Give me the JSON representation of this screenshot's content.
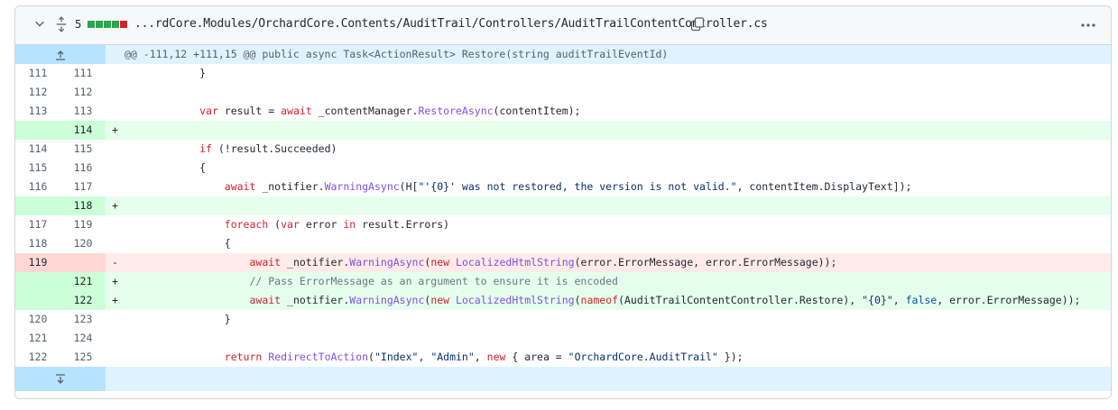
{
  "header": {
    "changes_count": "5",
    "change_blocks": [
      "added",
      "added",
      "added",
      "added",
      "deleted"
    ],
    "file_path": "...rdCore.Modules/OrchardCore.Contents/AuditTrail/Controllers/AuditTrailContentController.cs",
    "icons": [
      "chevron-down-icon",
      "unfold-icon",
      "copy-icon",
      "kebab-horizontal-icon"
    ]
  },
  "hunk": {
    "header_text": "@@ -111,12 +111,15 @@ public async Task<ActionResult> Restore(string auditTrailEventId)"
  },
  "colors": {
    "added_bg": "#e6ffec",
    "added_num_bg": "#ccffd8",
    "deleted_bg": "#ffebe9",
    "deleted_num_bg": "#ffd7d5",
    "hunk_bg": "#ddf4ff",
    "keyword": "#cf222e",
    "method": "#8250df",
    "string": "#0a3069",
    "comment": "#6e7781"
  },
  "lines": [
    {
      "type": "ctx",
      "old": "111",
      "new": "111",
      "sign": "",
      "tokens": [
        {
          "t": "            }",
          "c": ""
        }
      ]
    },
    {
      "type": "ctx",
      "old": "112",
      "new": "112",
      "sign": "",
      "tokens": [
        {
          "t": "",
          "c": ""
        }
      ]
    },
    {
      "type": "ctx",
      "old": "113",
      "new": "113",
      "sign": "",
      "tokens": [
        {
          "t": "            ",
          "c": ""
        },
        {
          "t": "var",
          "c": "kw"
        },
        {
          "t": " result = ",
          "c": ""
        },
        {
          "t": "await",
          "c": "kw"
        },
        {
          "t": " _contentManager.",
          "c": ""
        },
        {
          "t": "RestoreAsync",
          "c": "fn"
        },
        {
          "t": "(contentItem);",
          "c": ""
        }
      ]
    },
    {
      "type": "add",
      "old": "",
      "new": "114",
      "sign": "+",
      "tokens": [
        {
          "t": "",
          "c": ""
        }
      ]
    },
    {
      "type": "ctx",
      "old": "114",
      "new": "115",
      "sign": "",
      "tokens": [
        {
          "t": "            ",
          "c": ""
        },
        {
          "t": "if",
          "c": "kw"
        },
        {
          "t": " (!result.Succeeded)",
          "c": ""
        }
      ]
    },
    {
      "type": "ctx",
      "old": "115",
      "new": "116",
      "sign": "",
      "tokens": [
        {
          "t": "            {",
          "c": ""
        }
      ]
    },
    {
      "type": "ctx",
      "old": "116",
      "new": "117",
      "sign": "",
      "tokens": [
        {
          "t": "                ",
          "c": ""
        },
        {
          "t": "await",
          "c": "kw"
        },
        {
          "t": " _notifier.",
          "c": ""
        },
        {
          "t": "WarningAsync",
          "c": "fn"
        },
        {
          "t": "(H[",
          "c": ""
        },
        {
          "t": "\"'{0}' was not restored, the version is not valid.\"",
          "c": "str"
        },
        {
          "t": ", contentItem.DisplayText]);",
          "c": ""
        }
      ]
    },
    {
      "type": "add",
      "old": "",
      "new": "118",
      "sign": "+",
      "tokens": [
        {
          "t": "",
          "c": ""
        }
      ]
    },
    {
      "type": "ctx",
      "old": "117",
      "new": "119",
      "sign": "",
      "tokens": [
        {
          "t": "                ",
          "c": ""
        },
        {
          "t": "foreach",
          "c": "kw"
        },
        {
          "t": " (",
          "c": ""
        },
        {
          "t": "var",
          "c": "kw"
        },
        {
          "t": " error ",
          "c": ""
        },
        {
          "t": "in",
          "c": "kw"
        },
        {
          "t": " result.Errors)",
          "c": ""
        }
      ]
    },
    {
      "type": "ctx",
      "old": "118",
      "new": "120",
      "sign": "",
      "tokens": [
        {
          "t": "                {",
          "c": ""
        }
      ]
    },
    {
      "type": "del",
      "old": "119",
      "new": "",
      "sign": "-",
      "tokens": [
        {
          "t": "                    ",
          "c": ""
        },
        {
          "t": "await",
          "c": "kw"
        },
        {
          "t": " _notifier.",
          "c": ""
        },
        {
          "t": "WarningAsync",
          "c": "fn"
        },
        {
          "t": "(",
          "c": ""
        },
        {
          "t": "new",
          "c": "kw"
        },
        {
          "t": " ",
          "c": ""
        },
        {
          "t": "LocalizedHtmlString",
          "c": "fn"
        },
        {
          "t": "(error.ErrorMessage, error.ErrorMessage));",
          "c": ""
        }
      ]
    },
    {
      "type": "add",
      "old": "",
      "new": "121",
      "sign": "+",
      "tokens": [
        {
          "t": "                    ",
          "c": ""
        },
        {
          "t": "// Pass ErrorMessage as an argument to ensure it is encoded",
          "c": "cm"
        }
      ]
    },
    {
      "type": "add",
      "old": "",
      "new": "122",
      "sign": "+",
      "tokens": [
        {
          "t": "                    ",
          "c": ""
        },
        {
          "t": "await",
          "c": "kw"
        },
        {
          "t": " _notifier.",
          "c": ""
        },
        {
          "t": "WarningAsync",
          "c": "fn"
        },
        {
          "t": "(",
          "c": ""
        },
        {
          "t": "new",
          "c": "kw"
        },
        {
          "t": " ",
          "c": ""
        },
        {
          "t": "LocalizedHtmlString",
          "c": "fn"
        },
        {
          "t": "(",
          "c": ""
        },
        {
          "t": "nameof",
          "c": "kw"
        },
        {
          "t": "(AuditTrailContentController.Restore), ",
          "c": ""
        },
        {
          "t": "\"{0}\"",
          "c": "str"
        },
        {
          "t": ", ",
          "c": ""
        },
        {
          "t": "false",
          "c": "bool"
        },
        {
          "t": ", error.ErrorMessage));",
          "c": ""
        }
      ]
    },
    {
      "type": "ctx",
      "old": "120",
      "new": "123",
      "sign": "",
      "tokens": [
        {
          "t": "                }",
          "c": ""
        }
      ]
    },
    {
      "type": "ctx",
      "old": "121",
      "new": "124",
      "sign": "",
      "tokens": [
        {
          "t": "",
          "c": ""
        }
      ]
    },
    {
      "type": "ctx",
      "old": "122",
      "new": "125",
      "sign": "",
      "tokens": [
        {
          "t": "                ",
          "c": ""
        },
        {
          "t": "return",
          "c": "kw"
        },
        {
          "t": " ",
          "c": ""
        },
        {
          "t": "RedirectToAction",
          "c": "fn"
        },
        {
          "t": "(",
          "c": ""
        },
        {
          "t": "\"Index\"",
          "c": "str"
        },
        {
          "t": ", ",
          "c": ""
        },
        {
          "t": "\"Admin\"",
          "c": "str"
        },
        {
          "t": ", ",
          "c": ""
        },
        {
          "t": "new",
          "c": "kw"
        },
        {
          "t": " { area = ",
          "c": ""
        },
        {
          "t": "\"OrchardCore.AuditTrail\"",
          "c": "str"
        },
        {
          "t": " });",
          "c": ""
        }
      ]
    }
  ]
}
